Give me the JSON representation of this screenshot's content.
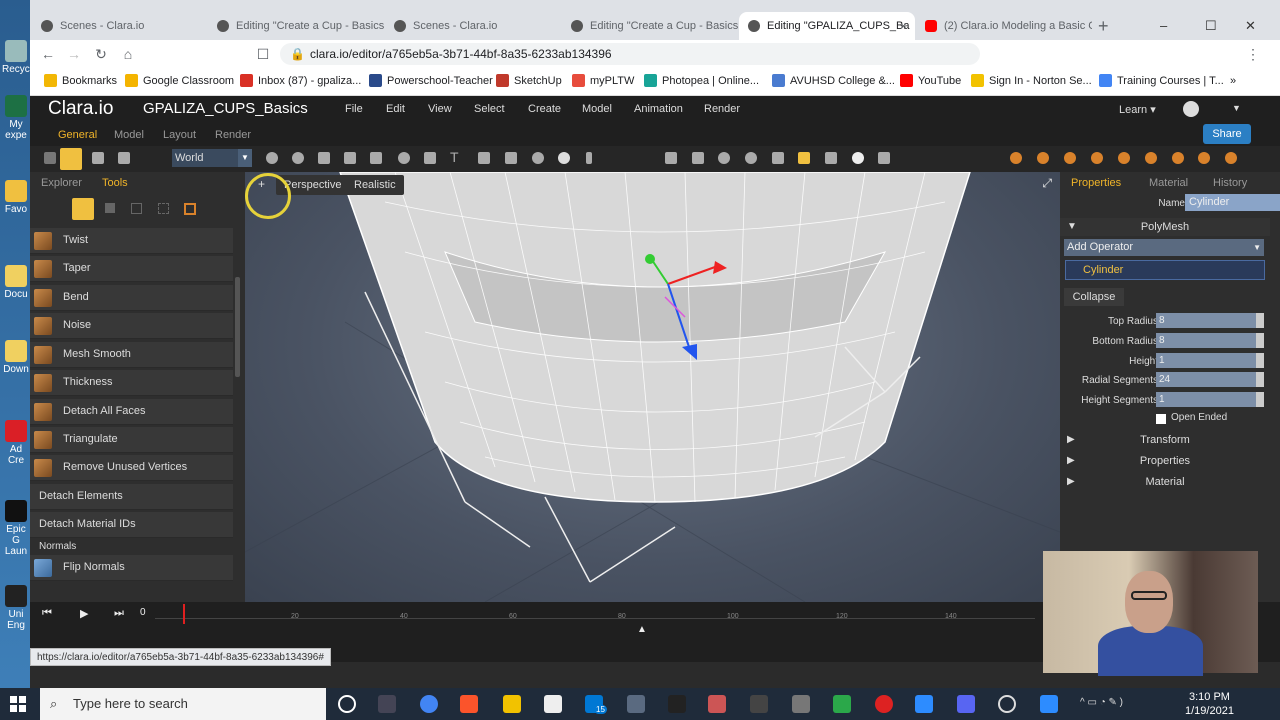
{
  "desktop": {
    "icons": [
      "Recycl",
      "My expe",
      "Favo",
      "Docu",
      "Down",
      "Ad Cre",
      "Epic G Laun",
      "Uni Eng"
    ]
  },
  "browser": {
    "tabs": [
      {
        "label": "Scenes - Clara.io"
      },
      {
        "label": "Editing \"Create a Cup - Basics\" - C"
      },
      {
        "label": "Scenes - Clara.io"
      },
      {
        "label": "Editing \"Create a Cup - Basics\" -"
      },
      {
        "label": "Editing \"GPALIZA_CUPS_Ba"
      },
      {
        "label": "(2) Clara.io Modeling a Basic Cof"
      }
    ],
    "tab_close": "×",
    "new_tab": "+",
    "url": "clara.io/editor/a765eb5a-3b71-44bf-8a35-6233ab134396",
    "window_controls": {
      "minimize": "–",
      "maximize": "☐",
      "close": "✕"
    },
    "bookmarks": [
      {
        "label": "Bookmarks",
        "color": "#f2b705"
      },
      {
        "label": "Google Classroom",
        "color": "#f4b400"
      },
      {
        "label": "Inbox (87) - gpaliza...",
        "color": "#d93025"
      },
      {
        "label": "Powerschool-Teacher",
        "color": "#2a4a8a"
      },
      {
        "label": "SketchUp",
        "color": "#c0392b"
      },
      {
        "label": "myPLTW",
        "color": "#e74c3c"
      },
      {
        "label": "Photopea | Online...",
        "color": "#18a497"
      },
      {
        "label": "AVUHSD College &...",
        "color": "#4a7bd0"
      },
      {
        "label": "YouTube",
        "color": "#ff0000"
      },
      {
        "label": "Sign In - Norton Se...",
        "color": "#f2c200"
      },
      {
        "label": "Training Courses | T...",
        "color": "#4285f4"
      }
    ],
    "bookmarks_more": "»",
    "status_url": "https://clara.io/editor/a765eb5a-3b71-44bf-8a35-6233ab134396#"
  },
  "app": {
    "logo": "Clara.io",
    "scene_title": "GPALIZA_CUPS_Basics",
    "menu": [
      "File",
      "Edit",
      "View",
      "Select",
      "Create",
      "Model",
      "Animation",
      "Render"
    ],
    "learn": "Learn ▾",
    "share": "Share",
    "modes": [
      "General",
      "Model",
      "Layout",
      "Render"
    ],
    "active_mode": "General",
    "coord_space": "World",
    "left_tabs": [
      "Explorer",
      "Tools"
    ],
    "active_left_tab": "Tools",
    "tools": [
      {
        "label": "Twist",
        "icon": "twist-icon"
      },
      {
        "label": "Taper",
        "icon": "taper-icon"
      },
      {
        "label": "Bend",
        "icon": "bend-icon"
      },
      {
        "label": "Noise",
        "icon": "noise-icon"
      },
      {
        "label": "Mesh Smooth",
        "icon": "mesh-smooth-icon"
      },
      {
        "label": "Thickness",
        "icon": "thickness-icon"
      },
      {
        "label": "Detach All Faces",
        "icon": "detach-faces-icon"
      },
      {
        "label": "Triangulate",
        "icon": "triangulate-icon"
      },
      {
        "label": "Remove Unused Vertices",
        "icon": "remove-vertices-icon"
      }
    ],
    "tools_plain": [
      "Detach Elements",
      "Detach Material IDs"
    ],
    "normals_section": "Normals",
    "normals_tools": [
      {
        "label": "Flip Normals",
        "icon": "flip-normals-icon"
      }
    ],
    "viewport": {
      "camera": "Perspective",
      "shading": "Realistic",
      "add_symbol": "+"
    },
    "right_tabs": [
      "Properties",
      "Material",
      "History"
    ],
    "active_right_tab": "Properties",
    "props": {
      "name_label": "Name",
      "name_value": "Cylinder",
      "polymesh": "PolyMesh",
      "add_operator": "Add Operator",
      "operator_item": "Cylinder",
      "collapse": "Collapse",
      "fields": [
        {
          "label": "Top Radius",
          "value": "8"
        },
        {
          "label": "Bottom Radius",
          "value": "8"
        },
        {
          "label": "Height",
          "value": "1"
        },
        {
          "label": "Radial Segments",
          "value": "24"
        },
        {
          "label": "Height Segments",
          "value": "1"
        }
      ],
      "open_ended": "Open Ended",
      "sections": [
        "Transform",
        "Properties",
        "Material"
      ]
    },
    "timeline": {
      "frame": "0",
      "ticks": [
        "20",
        "40",
        "60",
        "80",
        "100",
        "120",
        "140"
      ]
    }
  },
  "taskbar": {
    "search_placeholder": "Type here to search",
    "mail_badge": "15",
    "time": "3:10 PM",
    "date": "1/19/2021"
  }
}
